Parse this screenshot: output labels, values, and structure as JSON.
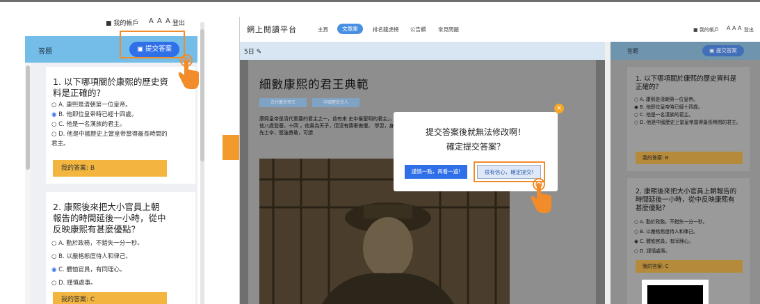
{
  "left_panel": {
    "account_label": "我的帳戶",
    "font_size": "A A A",
    "logout": "登出",
    "header_title": "答題",
    "submit_label": "提交答案",
    "questions": [
      {
        "text": "1. 以下哪項關於康熙的歷史資料是正確的？",
        "options": [
          "A. 康熙是清朝第一位皇帝。",
          "B. 他即位皇帝時已經十四歲。",
          "C. 他是一名漢族的君主。",
          "D. 他是中國歷史上當皇帝當得最長時間的君主。"
        ],
        "selected": 1,
        "answer": "我的答案: B"
      },
      {
        "text": "2. 康熙後來把大小官員上朝報告的時間延後一小時，從中反映康熙有甚麼優點？",
        "options": [
          "A. 勤於政務，不錯失一分一秒。",
          "B. 以嚴格態度待人和律己。",
          "C. 體恤官員，有同理心。",
          "D. 謹慎處事。"
        ],
        "selected": 2,
        "answer": "我的答案: C"
      }
    ]
  },
  "right_window": {
    "brand": "網上閱讀平台",
    "nav": [
      "主頁",
      "文章庫",
      "排名龍虎榜",
      "公告欄",
      "常見問題"
    ],
    "active_nav": "文章庫",
    "account_label": "我的帳戶",
    "font_size": "A A A",
    "logout": "登出",
    "date_fragment": "5日",
    "article_title": "細數康熙的君王典範",
    "tags": [
      "古代著名帝王",
      "中國歷史名人"
    ],
    "para": "康熙皇帝是清代重要的君主之一，曾有來 史中最聖明的君主」，他八歲登基，十四 ，他貴為天子，但沒有嬌奢傲慢， 學習，身先士卒，堅強勇敢，可謂",
    "sidebar_title": "答題",
    "sidebar_submit": "提交答案",
    "questions": [
      {
        "text": "1. 以下哪項關於康熙的歷史資料是正確的？",
        "options": [
          "A. 康熙是清朝第一位皇帝。",
          "B. 他即位皇帝時已經十四歲。",
          "C. 他是一名漢族的君主。",
          "D. 他是中國歷史上當皇帝當得最長時間的君主。"
        ],
        "selected": 1,
        "answer": "我的答案: B"
      },
      {
        "text": "2. 康熙後來把大小官員上朝報告的時間延後一小時，從中反映康熙有甚麼優點？",
        "options": [
          "A. 勤於政務，不錯失一分一秒。",
          "B. 以嚴格態度待人和律己。",
          "C. 體恤官員，有同理心。",
          "D. 謹慎處事。"
        ],
        "selected": 2,
        "answer": "我的答案: C"
      }
    ]
  },
  "modal": {
    "line1": "提交答案後就無法修改啊！",
    "line2": "確定提交答案？",
    "cancel": "謹慎一點，再看一遍!",
    "confirm": "很有信心，確定提交!"
  },
  "colors": {
    "accent": "#2f6fe8",
    "highlight": "#f28c2b",
    "answer_bg": "#f2b640",
    "header_bar": "#73bde8"
  }
}
